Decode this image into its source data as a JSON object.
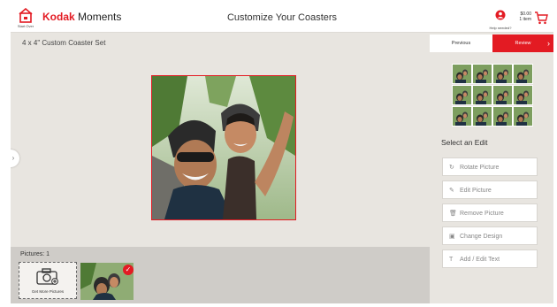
{
  "header": {
    "start_over_label": "Start Over",
    "logo_brand": "Kodak",
    "logo_suffix": "Moments",
    "page_title": "Customize Your Coasters",
    "help_label": "Help needed?",
    "cart_price": "$0.00",
    "cart_items": "1 item"
  },
  "canvas": {
    "set_title": "4 x 4\" Custom Coaster Set"
  },
  "nav": {
    "previous_label": "Previous",
    "review_label": "Review"
  },
  "edit_panel": {
    "title": "Select an Edit",
    "buttons": [
      {
        "label": "Rotate Picture",
        "icon": "rotate-icon"
      },
      {
        "label": "Edit Picture",
        "icon": "edit-icon"
      },
      {
        "label": "Remove Picture",
        "icon": "trash-icon"
      },
      {
        "label": "Change Design",
        "icon": "design-icon"
      },
      {
        "label": "Add / Edit Text",
        "icon": "text-icon"
      }
    ]
  },
  "tray": {
    "title": "Pictures: 1",
    "get_more_label": "Get More Pictures"
  },
  "colors": {
    "brand_red": "#e31b23",
    "background": "#e8e5e0",
    "tray": "#cfccc8"
  }
}
